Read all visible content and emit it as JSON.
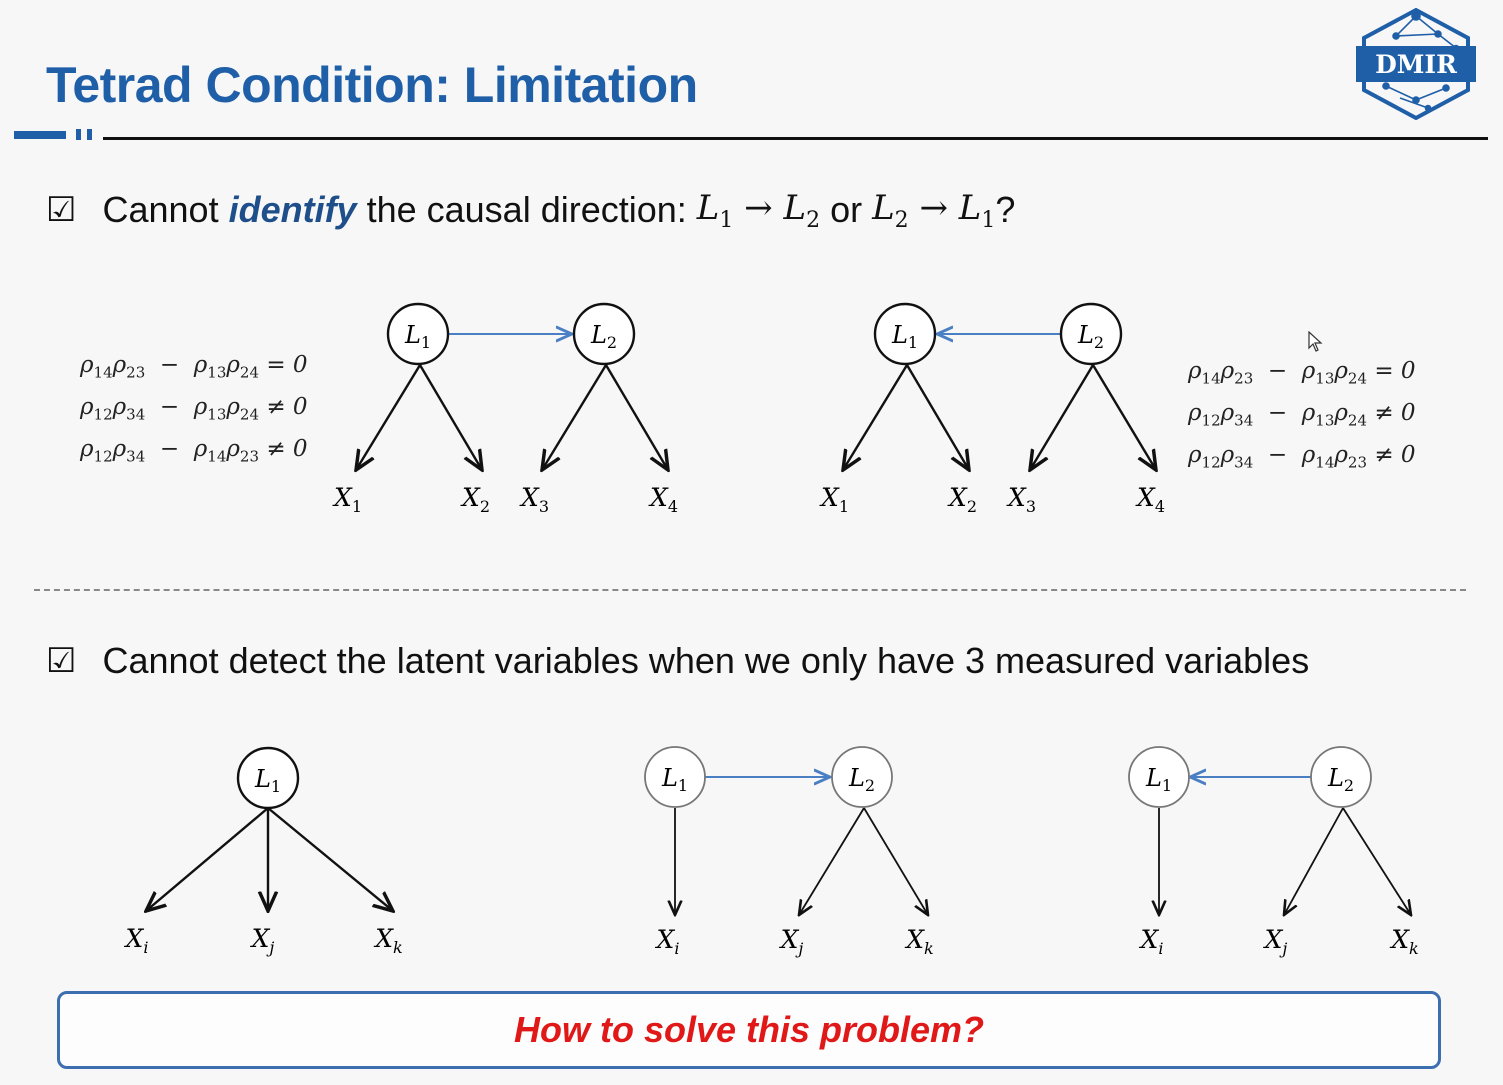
{
  "slide": {
    "title": "Tetrad Condition: Limitation",
    "logo_text": "DMIR"
  },
  "bullet1": {
    "prefix": "Cannot ",
    "emphasis": "identify",
    "middle": " the causal direction: ",
    "or_word": " or ",
    "question": "?"
  },
  "bullet2": {
    "text": "Cannot detect the latent variables when we only have 3 measured variables"
  },
  "equations_left": [
    "ρ14ρ23  −  ρ13ρ24 = 0",
    "ρ12ρ34  −  ρ13ρ24 ≠ 0",
    "ρ12ρ34  −  ρ14ρ23 ≠ 0"
  ],
  "equations_right": [
    "ρ14ρ23  −  ρ13ρ24 = 0",
    "ρ12ρ34  −  ρ13ρ24 ≠ 0",
    "ρ12ρ34  −  ρ14ρ23 ≠ 0"
  ],
  "diagrams": {
    "latent_labels": [
      "L1",
      "L2"
    ],
    "observed_labels_top": [
      "X1",
      "X2",
      "X3",
      "X4"
    ],
    "observed_labels_bottom": [
      "Xi",
      "Xj",
      "Xk"
    ]
  },
  "callout": {
    "text": "How to solve this problem?"
  },
  "colors": {
    "title_blue": "#1f5fa8",
    "edge_blue": "#4a7fc4",
    "callout_red": "#e01818",
    "box_border": "#3d6fb0"
  }
}
